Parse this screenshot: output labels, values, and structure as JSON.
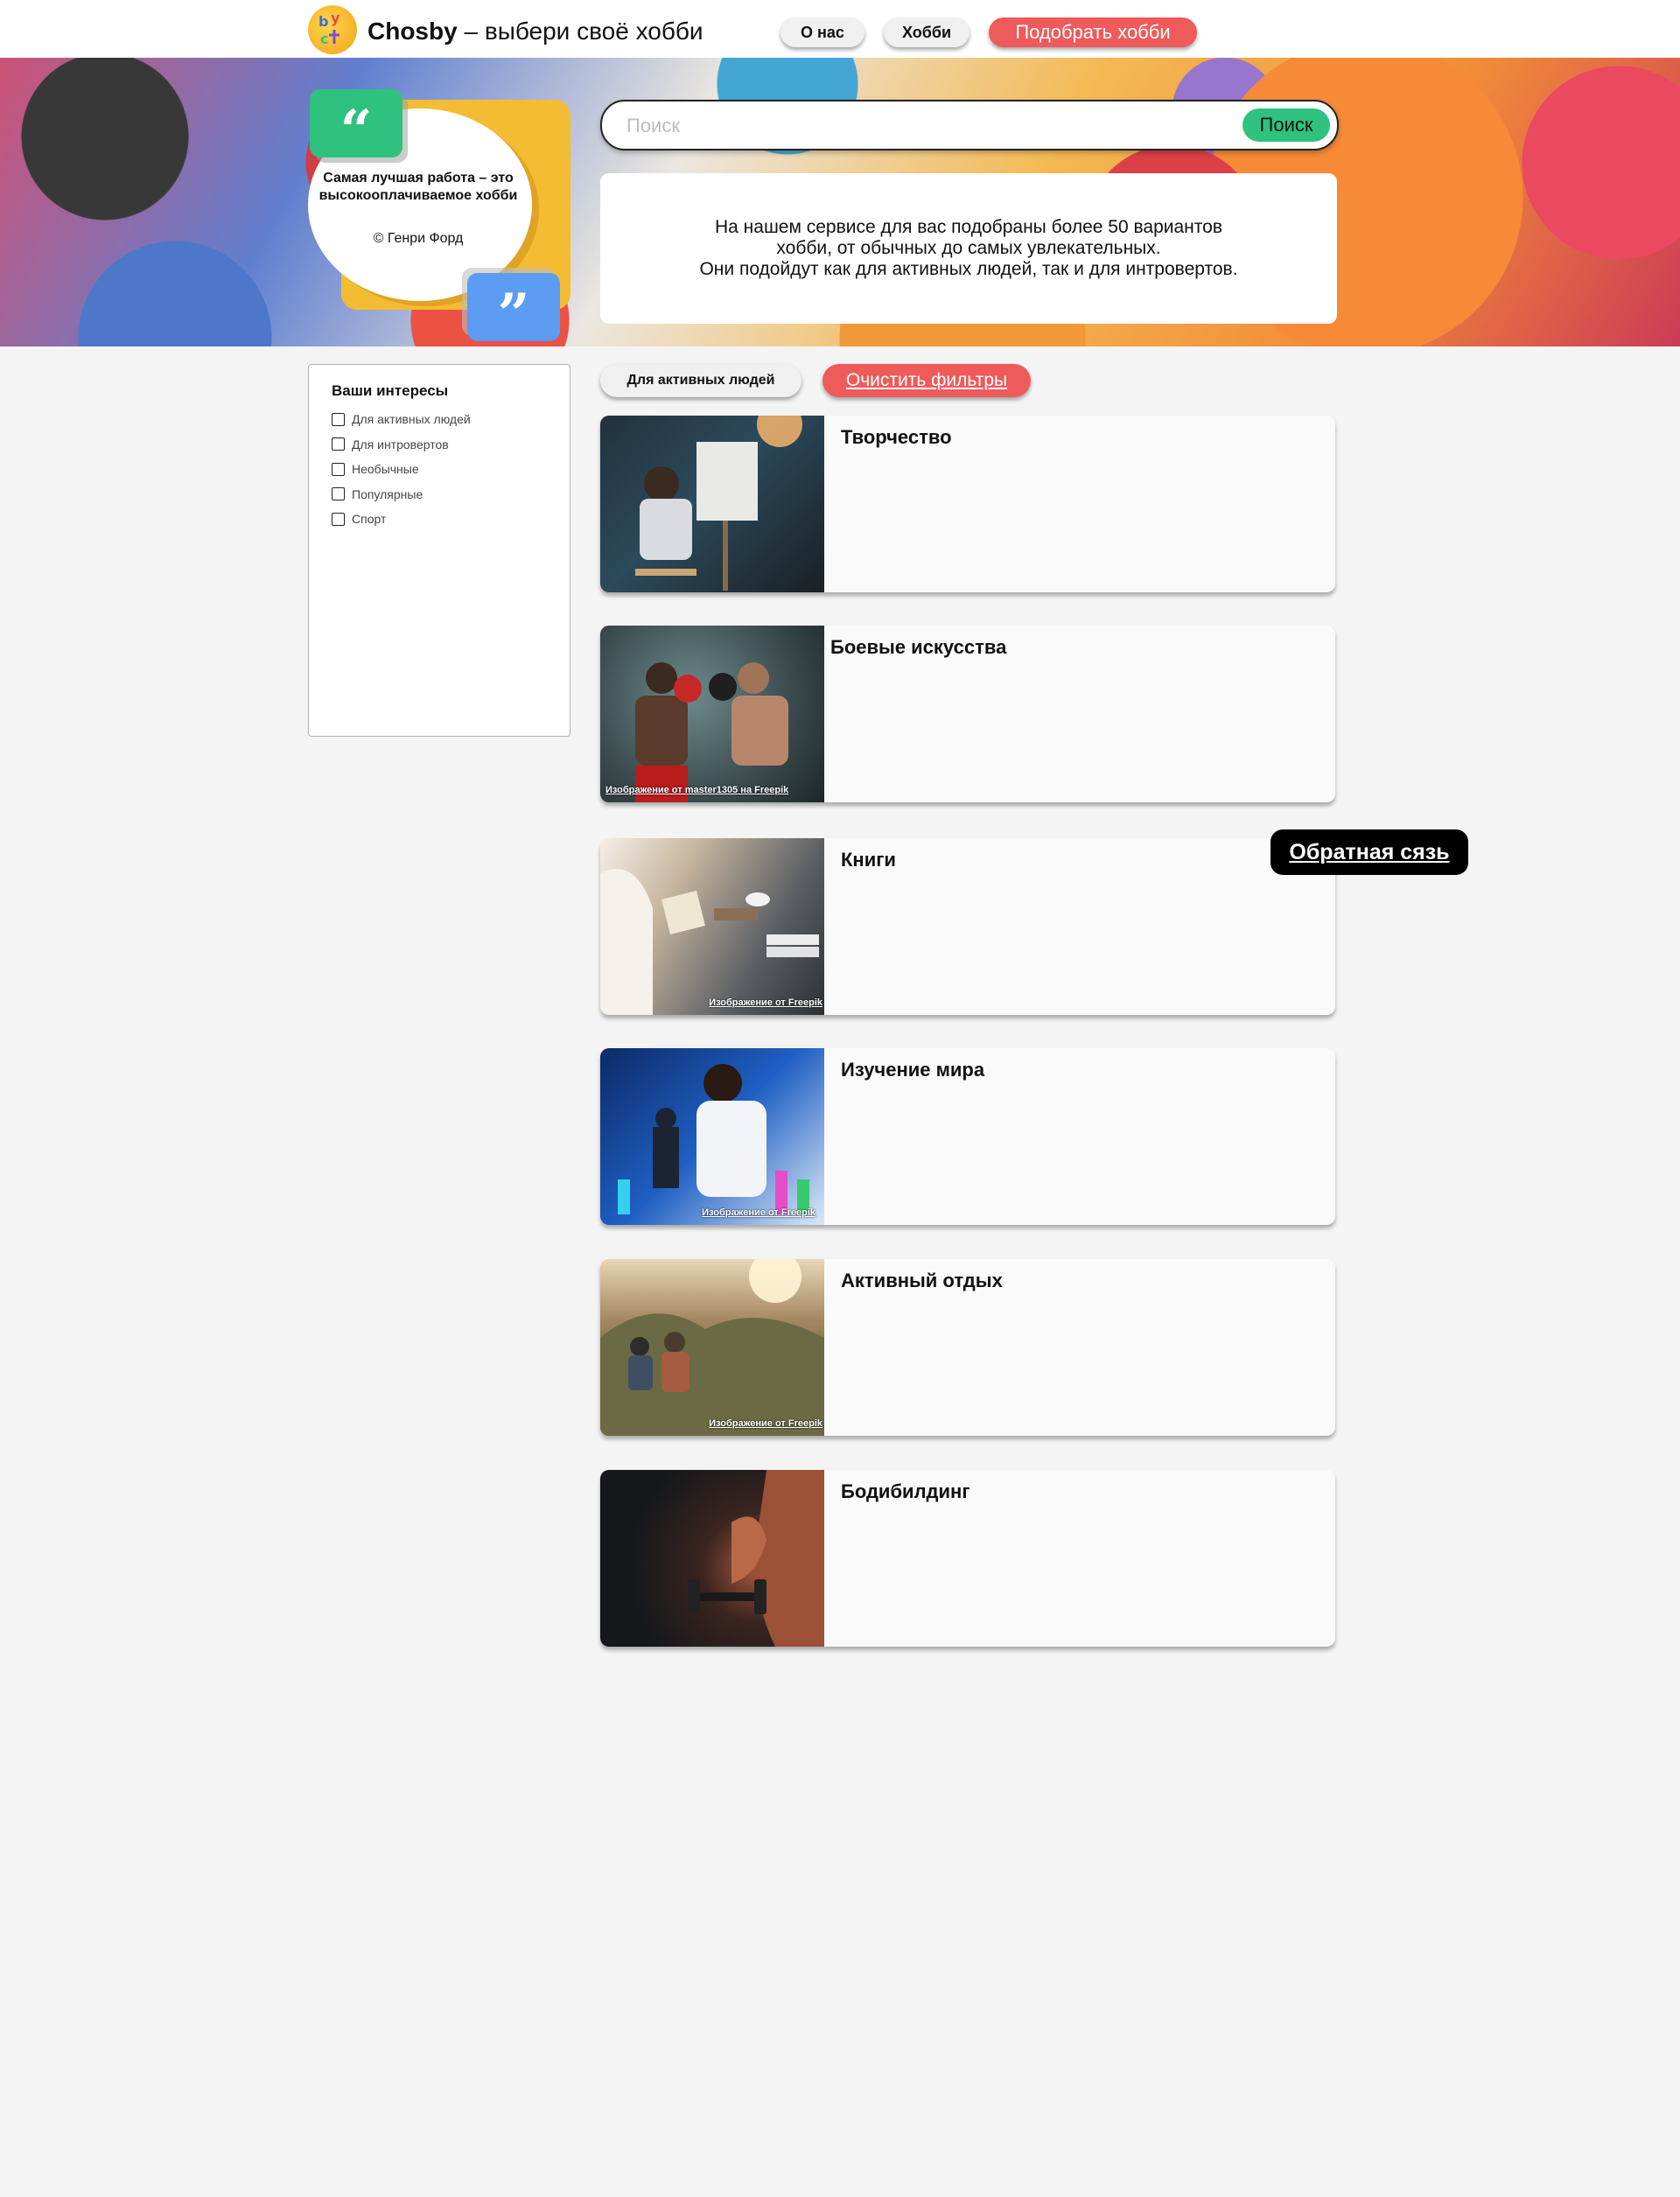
{
  "header": {
    "brand_name": "Chosby",
    "brand_tagline": " – выбери своё хобби",
    "nav": [
      {
        "label": "О нас"
      },
      {
        "label": "Хобби"
      },
      {
        "label": "Подобрать хобби"
      }
    ]
  },
  "hero": {
    "quote": "Самая лучшая работа – это высокооплачиваемое хобби",
    "quote_author": "© Генри Форд",
    "quote_open_mark": "“",
    "quote_close_mark": "”",
    "search": {
      "placeholder": "Поиск",
      "value": "",
      "button_label": "Поиск"
    },
    "intro_lines": [
      "На нашем сервисе для вас подобраны более 50 вариантов",
      "хобби, от обычных до самых увлекательных.",
      "Они подойдут как для активных людей, так и для интровертов."
    ]
  },
  "sidebar": {
    "title": "Ваши интересы",
    "filters": [
      {
        "label": "Для активных людей",
        "checked": false
      },
      {
        "label": "Для интровертов",
        "checked": false
      },
      {
        "label": "Необычные",
        "checked": false
      },
      {
        "label": "Популярные",
        "checked": false
      },
      {
        "label": "Спорт",
        "checked": false
      }
    ]
  },
  "active_filters": {
    "chip": "Для активных людей",
    "clear_label": "Очистить фильтры"
  },
  "cards": [
    {
      "title": "Творчество",
      "credit": ""
    },
    {
      "title": "Боевые искусства",
      "credit": "Изображение от master1305 на Freepik"
    },
    {
      "title": "Книги",
      "credit": "Изображение от Freepik"
    },
    {
      "title": "Изучение мира",
      "credit": "Изображение от Freepik"
    },
    {
      "title": "Активный отдых",
      "credit": "Изображение от Freepik"
    },
    {
      "title": "Бодибилдинг",
      "credit": ""
    }
  ],
  "feedback_label": "Обратная сязь",
  "colors": {
    "accent_red": "#ef5a5a",
    "accent_green": "#2ec27e",
    "accent_blue": "#5c9cf2",
    "accent_yellow": "#f3bc32"
  }
}
